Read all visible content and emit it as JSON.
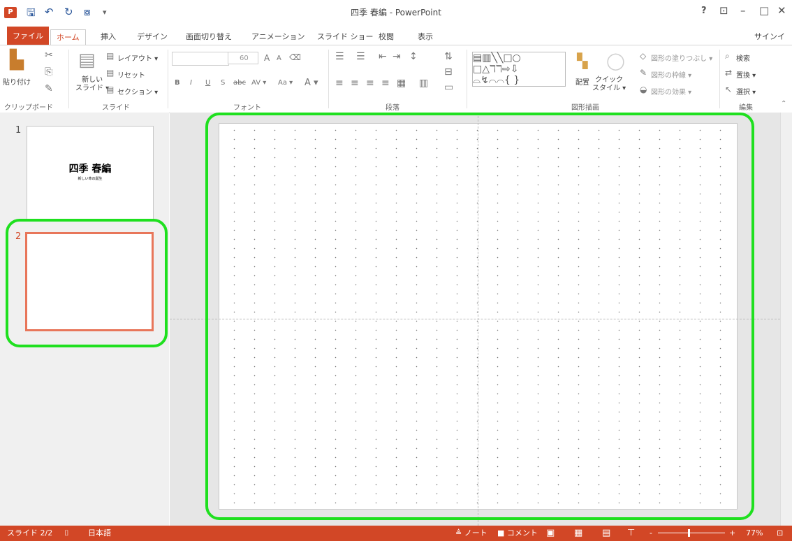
{
  "window": {
    "title": "四季 春編 - PowerPoint",
    "help": "?",
    "ribbon_display": "⊡",
    "minimize": "–",
    "maximize": "□",
    "close": "✕",
    "app_icon": "P",
    "save_icon": "🖫",
    "undo_icon": "↶",
    "redo_icon": "↻",
    "present_icon": "⧇",
    "qa_more": "▾"
  },
  "tabs": [
    "ファイル",
    "ホーム",
    "挿入",
    "デザイン",
    "画面切り替え",
    "アニメーション",
    "スライド ショー",
    "校閲",
    "表示"
  ],
  "signin": "サインイン",
  "ribbon": {
    "clipboard": {
      "paste": "貼り付け",
      "label": "クリップボード"
    },
    "slides": {
      "new_slide": "新しい\nスライド ▾",
      "layout": "レイアウト ▾",
      "reset": "リセット",
      "section": "セクション ▾",
      "label": "スライド"
    },
    "font": {
      "size": "60",
      "grow": "A",
      "shrink": "A",
      "bold": "B",
      "italic": "I",
      "underline": "U",
      "strike": "S",
      "abc": "abc",
      "spacing": "AV ▾",
      "case": "Aa ▾",
      "color": "A ▾",
      "label": "フォント"
    },
    "paragraph": {
      "label": "段落"
    },
    "drawing": {
      "arrange": "配置",
      "quick_style": "クイック\nスタイル ▾",
      "fill": "図形の塗りつぶし ▾",
      "outline": "図形の枠線 ▾",
      "effect": "図形の効果 ▾",
      "label": "図形描画"
    },
    "editing": {
      "find": "検索",
      "replace": "置換 ▾",
      "select": "選択 ▾",
      "label": "編集"
    }
  },
  "slides": [
    {
      "number": "1",
      "title": "四季  春編",
      "subtitle": "新しい命の誕生"
    },
    {
      "number": "2",
      "title": "",
      "subtitle": ""
    }
  ],
  "status": {
    "slide": "スライド 2/2",
    "language": "日本語",
    "notes": "≜ ノート",
    "comments": "■ コメント",
    "zoom": "77%",
    "zoom_minus": "-",
    "zoom_plus": "+"
  }
}
